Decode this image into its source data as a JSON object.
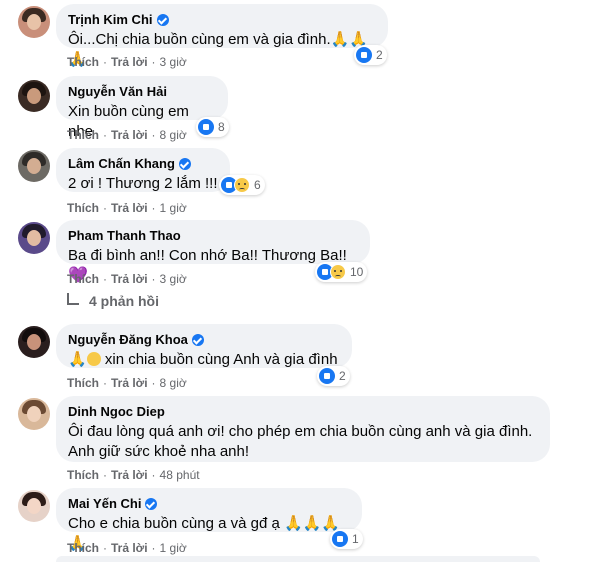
{
  "comments": [
    {
      "name": "Trịnh Kim Chi",
      "text": "Ôi...Chị chia buồn cùng em và gia đình.",
      "emoji": "🙏🙏🙏",
      "like": "Thích",
      "reply": "Trả lời",
      "time": "3 giờ",
      "react_count": "2"
    },
    {
      "name": "Nguyễn Văn Hải",
      "text": "Xin buồn cùng em nhe",
      "like": "Thích",
      "reply": "Trả lời",
      "time": "8 giờ",
      "react_count": "8"
    },
    {
      "name": "Lâm Chấn Khang",
      "text": "2 ơi ! Thương 2 lắm !!!",
      "like": "Thích",
      "reply": "Trả lời",
      "time": "1 giờ",
      "react_count": "6"
    },
    {
      "name": "Pham Thanh Thao",
      "text": "Ba đi bình an!! Con nhớ Ba!! Thương Ba!!",
      "emoji": "💜",
      "like": "Thích",
      "reply": "Trả lời",
      "time": "3 giờ",
      "react_count": "10"
    },
    {
      "name": "Nguyễn Đăng Khoa",
      "text": "xin chia buồn cùng Anh và gia đình",
      "emoji": "🙏",
      "like": "Thích",
      "reply": "Trả lời",
      "time": "8 giờ",
      "react_count": "2"
    },
    {
      "name": "Dinh Ngoc Diep",
      "text": "Ôi đau lòng quá anh ơi! cho phép em chia buồn cùng anh và gia đình.\nAnh giữ sức khoẻ nha anh!",
      "like": "Thích",
      "reply": "Trả lời",
      "time": "48 phút"
    },
    {
      "name": "Mai Yến Chi",
      "text": "Cho e chia buồn cùng a và gđ ạ",
      "emoji": "🙏🙏🙏🙏",
      "like": "Thích",
      "reply": "Trả lời",
      "time": "1 giờ",
      "react_count": "1"
    }
  ],
  "replies_link": "4 phản hồi",
  "colors": {
    "accent": "#1877f2",
    "bubble": "#f0f2f5",
    "meta": "#65676b"
  }
}
